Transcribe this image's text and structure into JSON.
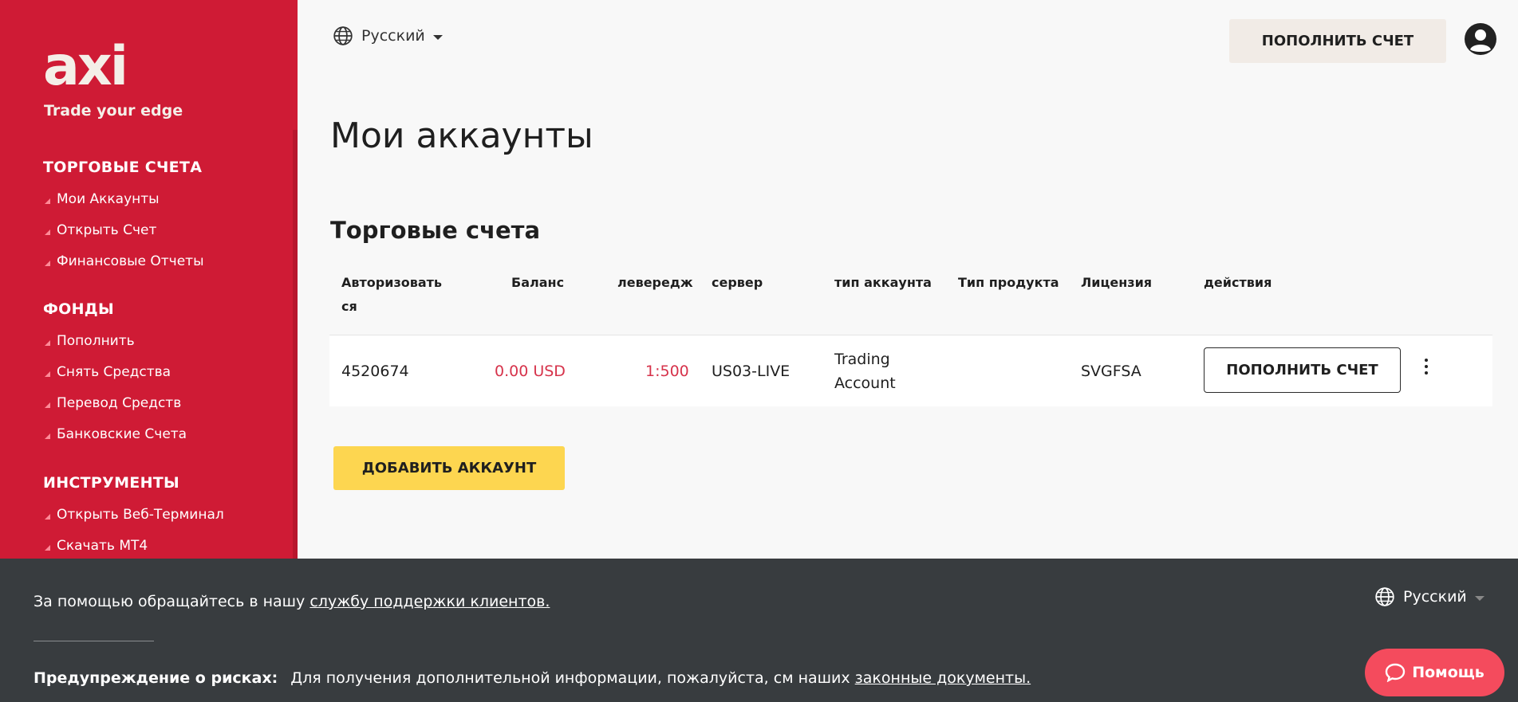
{
  "brand": {
    "logo_text": "axi",
    "tagline": "Trade your edge"
  },
  "sidebar": {
    "sections": [
      {
        "title": "ТОРГОВЫЕ СЧЕТА",
        "items": [
          "Мои Аккаунты",
          "Открыть Счет",
          "Финансовые Отчеты"
        ]
      },
      {
        "title": "ФОНДЫ",
        "items": [
          "Пополнить",
          "Снять Средства",
          "Перевод Средств",
          "Банковские Счета"
        ]
      },
      {
        "title": "ИНСТРУМЕНТЫ",
        "items": [
          "Открыть Веб-Терминал",
          "Скачать MT4"
        ]
      }
    ]
  },
  "topbar": {
    "language": "Русский",
    "deposit_label": "ПОПОЛНИТЬ СЧЕТ"
  },
  "main": {
    "title": "Мои аккаунты",
    "section_title": "Торговые счета",
    "table": {
      "headers": [
        "Авторизовать ся",
        "Баланс",
        "левередж",
        "сервер",
        "тип аккаунта",
        "Тип продукта",
        "Лицензия",
        "действия"
      ],
      "rows": [
        {
          "login": "4520674",
          "balance": "0.00 USD",
          "leverage": "1:500",
          "server": "US03-LIVE",
          "account_type": "Trading Account",
          "product_type": "",
          "license": "SVGFSA",
          "action_label": "ПОПОЛНИТЬ СЧЕТ"
        }
      ]
    },
    "add_account_label": "ДОБАВИТЬ АККАУНТ"
  },
  "footer": {
    "support_text": "За помощью обращайтесь в нашу",
    "support_link": "службу поддержки клиентов.",
    "risk_label": "Предупреждение о рисках:",
    "risk_text": "Для получения дополнительной информации, пожалуйста, см наших",
    "risk_link": "законные документы.",
    "language": "Русский",
    "help_label": "Помощь"
  },
  "colors": {
    "brand_red": "#cf1b35",
    "accent_yellow": "#fdd650",
    "footer_bg": "#383c3f",
    "help_pink": "#f44b5d",
    "value_red": "#d6334b"
  }
}
